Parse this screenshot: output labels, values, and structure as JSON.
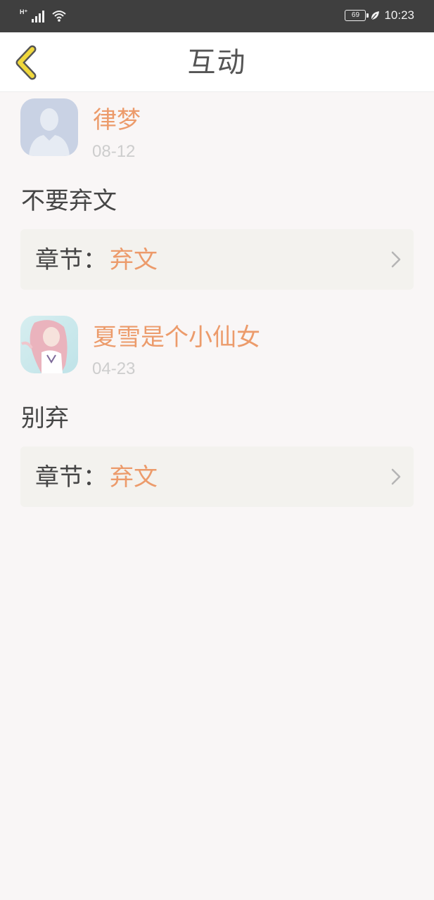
{
  "status_bar": {
    "network_type": "H⁺",
    "battery": "69",
    "time": "10:23"
  },
  "nav": {
    "title": "互动"
  },
  "items": [
    {
      "username": "律梦",
      "date": "08-12",
      "comment": "不要弃文",
      "chapter_prefix": "章节：",
      "chapter_name": "弃文"
    },
    {
      "username": "夏雪是个小仙女",
      "date": "04-23",
      "comment": "别弃",
      "chapter_prefix": "章节：",
      "chapter_name": "弃文"
    }
  ],
  "icons": {
    "back": "back-arrow-icon",
    "chevron": "chevron-right-icon",
    "signal": "signal-icon",
    "wifi": "wifi-icon",
    "battery": "battery-icon",
    "eco": "leaf-icon"
  },
  "colors": {
    "accent": "#ec9b6b",
    "back_arrow": "#f0d83c",
    "status_bar": "#3f3f3f"
  }
}
